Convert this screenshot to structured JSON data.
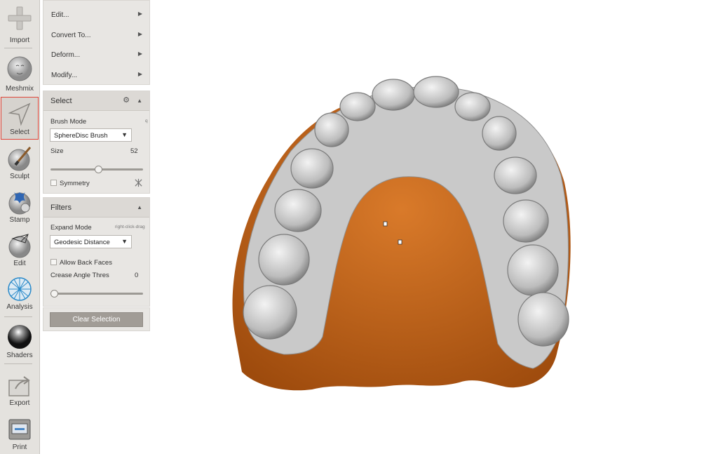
{
  "toolbar": {
    "import": "Import",
    "meshmix": "Meshmix",
    "select": "Select",
    "sculpt": "Sculpt",
    "stamp": "Stamp",
    "edit": "Edit",
    "analysis": "Analysis",
    "shaders": "Shaders",
    "export": "Export",
    "print": "Print"
  },
  "menu": {
    "edit": "Edit...",
    "convert": "Convert To...",
    "deform": "Deform...",
    "modify": "Modify..."
  },
  "select_panel": {
    "title": "Select",
    "brush_mode_label": "Brush Mode",
    "brush_mode_hint": "q",
    "brush_mode_value": "SphereDisc Brush",
    "size_label": "Size",
    "size_value": "52",
    "size_fraction": 0.52,
    "symmetry_label": "Symmetry"
  },
  "filters_panel": {
    "title": "Filters",
    "expand_mode_label": "Expand Mode",
    "expand_mode_hint": "right-click-drag",
    "expand_mode_value": "Geodesic Distance",
    "allow_back_faces_label": "Allow Back Faces",
    "crease_label": "Crease Angle Thres",
    "crease_value": "0",
    "crease_fraction": 0.0
  },
  "clear_selection_label": "Clear Selection",
  "colors": {
    "selection": "#c8661a",
    "mesh": "#cfcfcf",
    "accent": "#e0463a"
  }
}
